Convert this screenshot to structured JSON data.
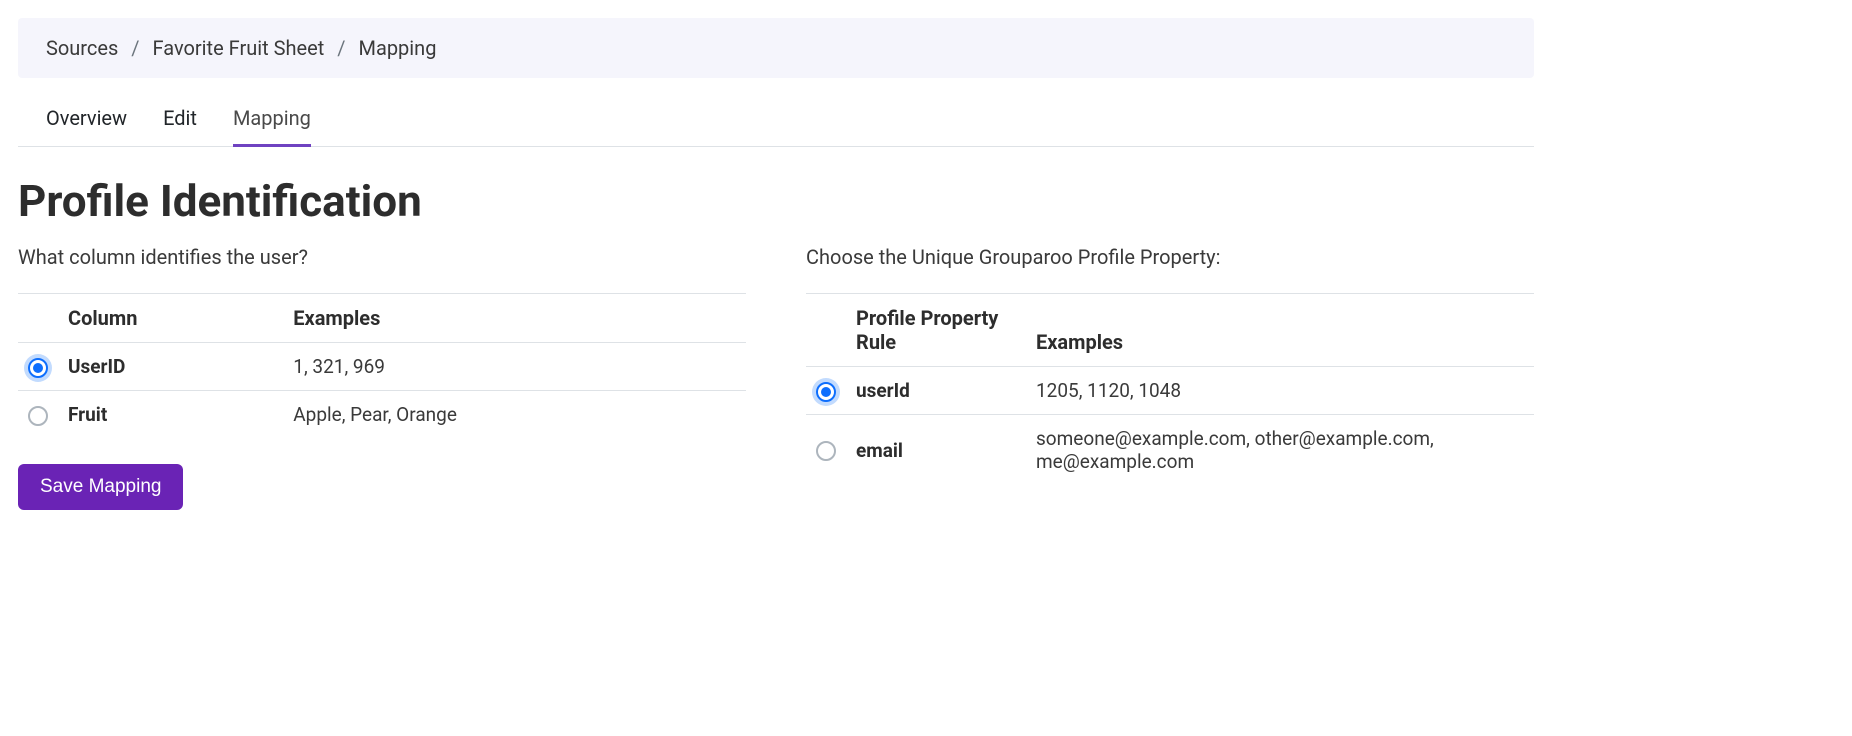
{
  "breadcrumb": {
    "items": [
      "Sources",
      "Favorite Fruit Sheet",
      "Mapping"
    ]
  },
  "tabs": {
    "items": [
      {
        "label": "Overview",
        "active": false
      },
      {
        "label": "Edit",
        "active": false
      },
      {
        "label": "Mapping",
        "active": true
      }
    ]
  },
  "page_title": "Profile Identification",
  "left": {
    "question": "What column identifies the user?",
    "headers": {
      "col1": "Column",
      "col2": "Examples"
    },
    "rows": [
      {
        "name": "UserID",
        "examples": "1, 321, 969",
        "selected": true
      },
      {
        "name": "Fruit",
        "examples": "Apple, Pear, Orange",
        "selected": false
      }
    ]
  },
  "right": {
    "question": "Choose the Unique Grouparoo Profile Property:",
    "headers": {
      "col1": "Profile Property Rule",
      "col2": "Examples"
    },
    "rows": [
      {
        "name": "userId",
        "examples": "1205, 1120, 1048",
        "selected": true
      },
      {
        "name": "email",
        "examples": "someone@example.com, other@example.com, me@example.com",
        "selected": false
      }
    ]
  },
  "save_button_label": "Save Mapping"
}
